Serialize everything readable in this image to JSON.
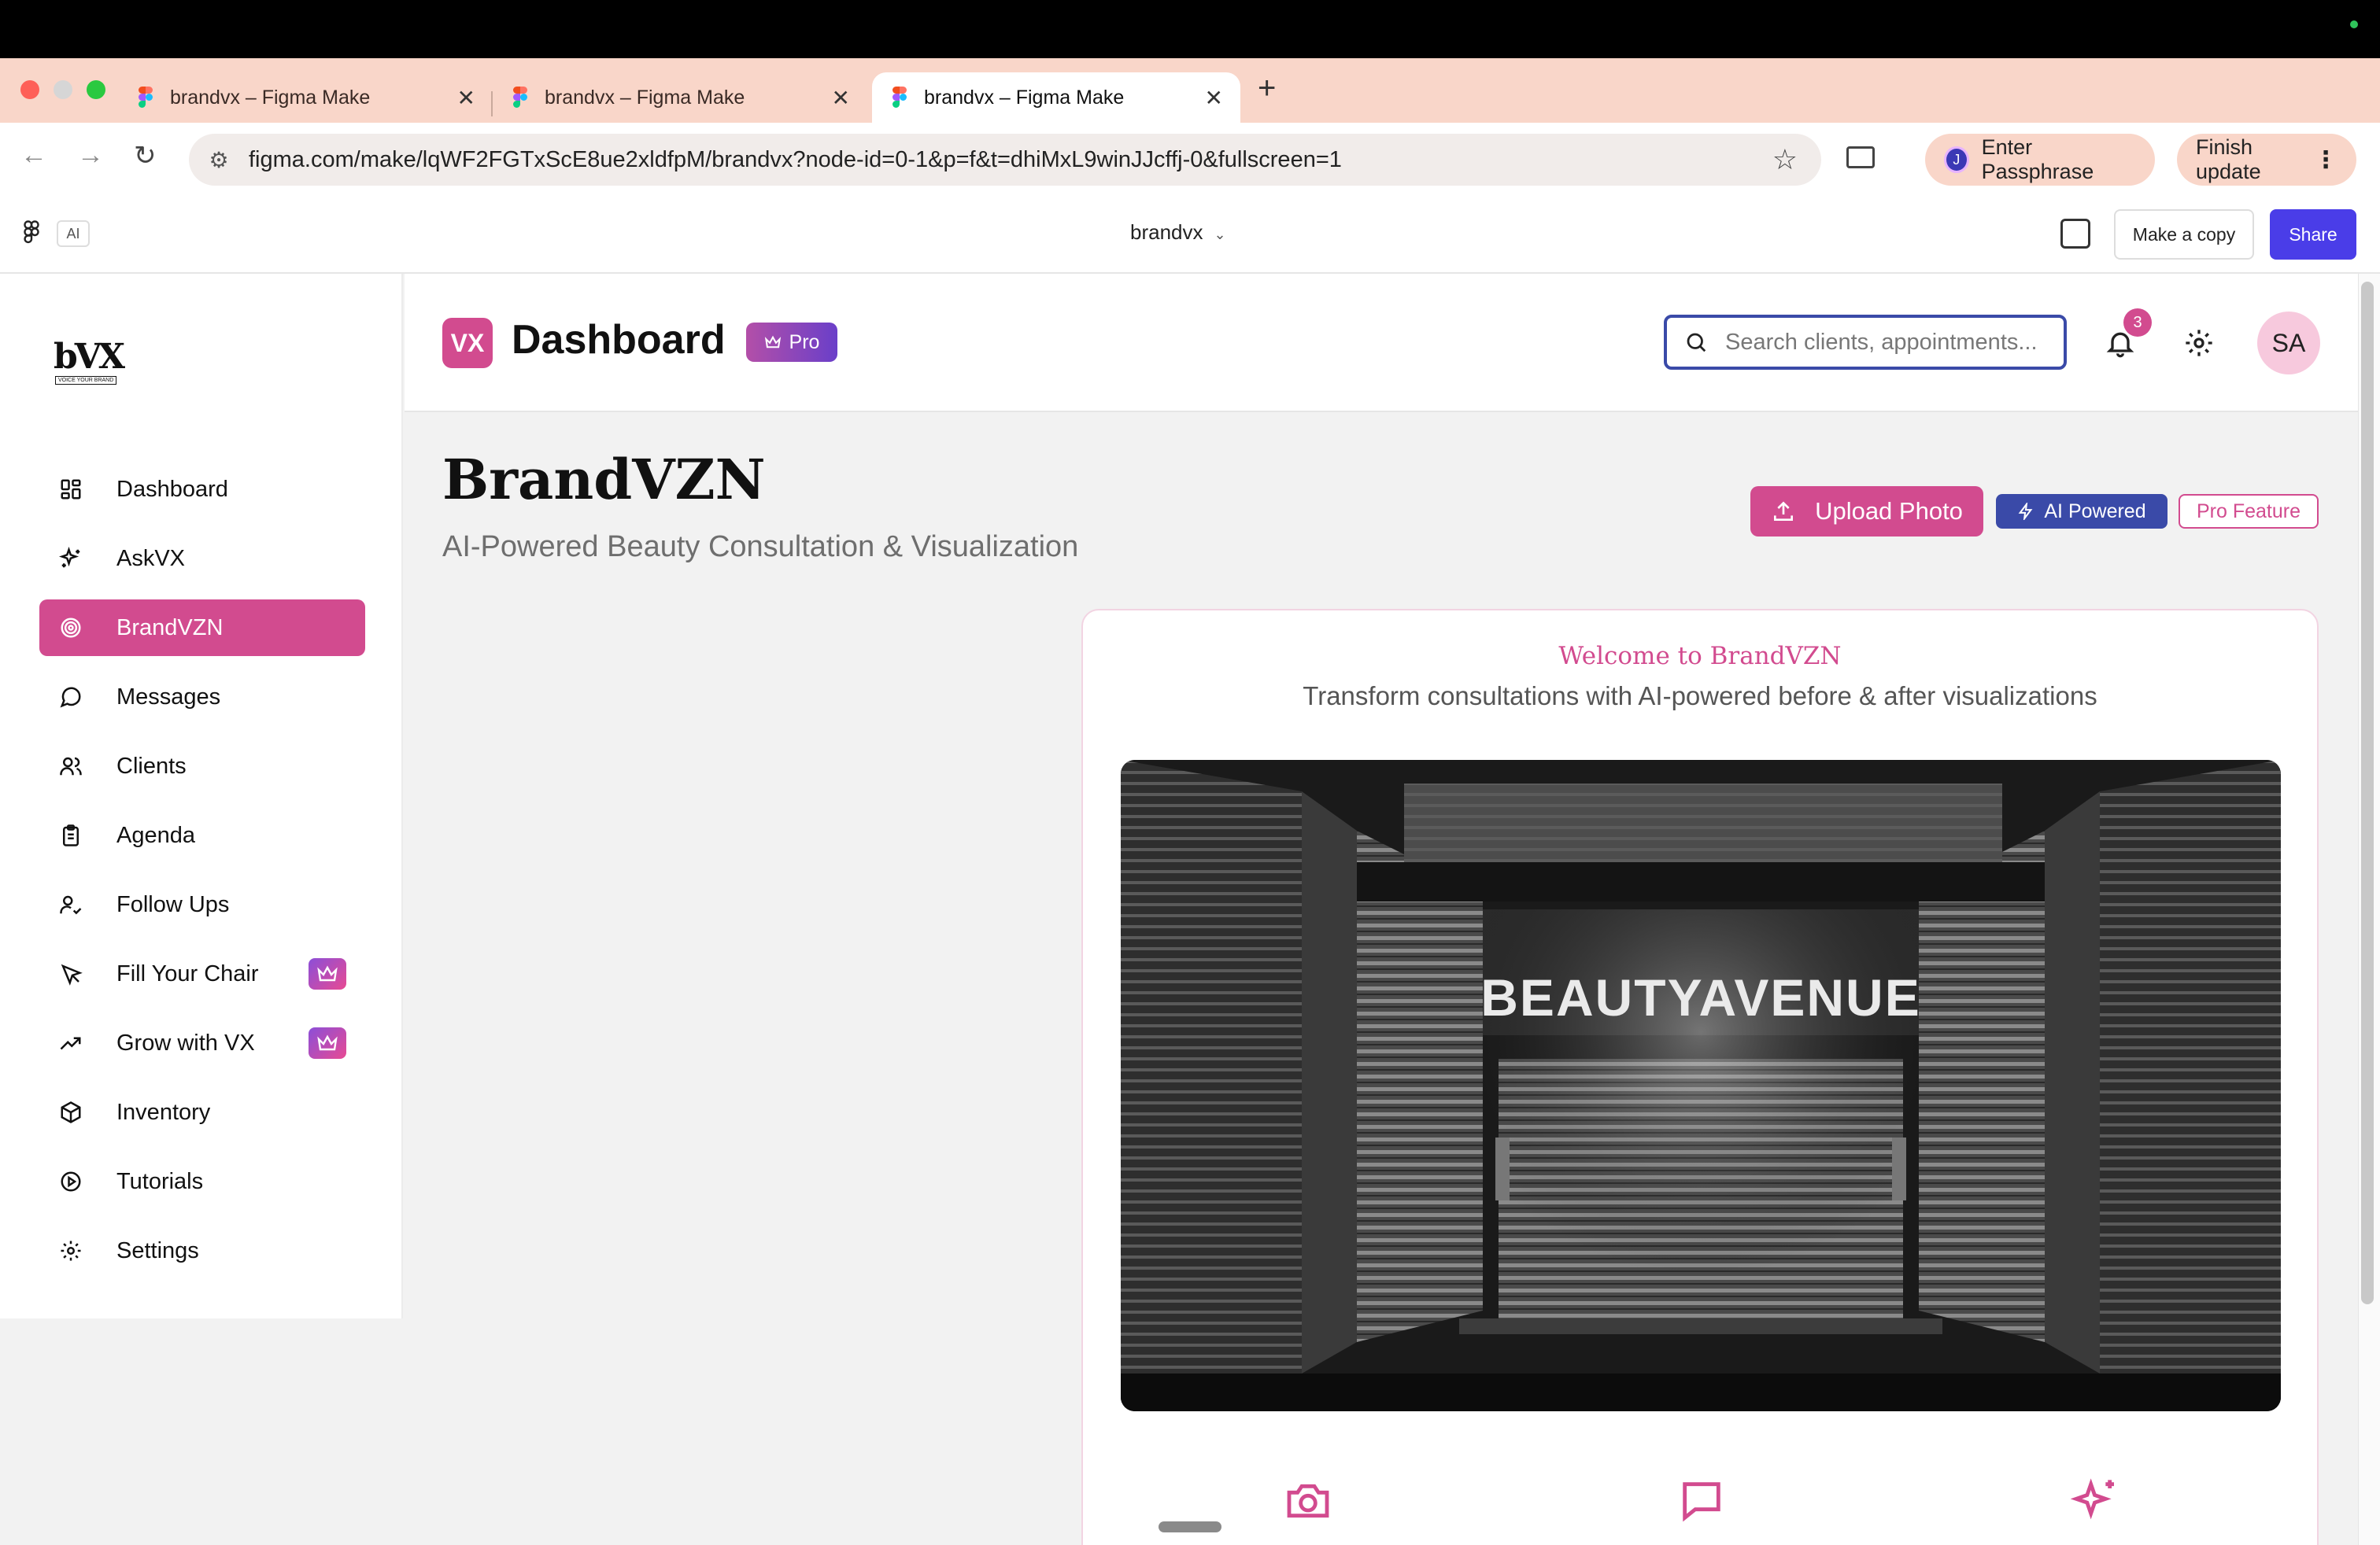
{
  "browser": {
    "tabs": [
      {
        "title": "brandvx – Figma Make",
        "close": "✕"
      },
      {
        "title": "brandvx – Figma Make",
        "close": "✕"
      },
      {
        "title": "brandvx – Figma Make",
        "close": "✕"
      }
    ],
    "new_tab": "+",
    "url": "figma.com/make/lqWF2FGTxScE8ue2xldfpM/brandvx?node-id=0-1&p=f&t=dhiMxL9winJJcffj-0&fullscreen=1",
    "profile_initial": "J",
    "passphrase_label": "Enter Passphrase",
    "update_label": "Finish update"
  },
  "figma": {
    "ai_tag": "AI",
    "file_name": "brandvx",
    "make_copy_label": "Make a copy",
    "share_label": "Share"
  },
  "sidebar": {
    "logo_text": "bVX",
    "logo_subtext": "VOICE YOUR BRAND",
    "items": [
      {
        "label": "Dashboard",
        "icon": "grid-icon",
        "active": false,
        "pro": false
      },
      {
        "label": "AskVX",
        "icon": "sparkles-icon",
        "active": false,
        "pro": false
      },
      {
        "label": "BrandVZN",
        "icon": "target-icon",
        "active": true,
        "pro": false
      },
      {
        "label": "Messages",
        "icon": "message-icon",
        "active": false,
        "pro": false
      },
      {
        "label": "Clients",
        "icon": "users-icon",
        "active": false,
        "pro": false
      },
      {
        "label": "Agenda",
        "icon": "clipboard-icon",
        "active": false,
        "pro": false
      },
      {
        "label": "Follow Ups",
        "icon": "user-check-icon",
        "active": false,
        "pro": false
      },
      {
        "label": "Fill Your Chair",
        "icon": "cursor-icon",
        "active": false,
        "pro": true
      },
      {
        "label": "Grow with VX",
        "icon": "trending-up-icon",
        "active": false,
        "pro": true
      },
      {
        "label": "Inventory",
        "icon": "box-icon",
        "active": false,
        "pro": false
      },
      {
        "label": "Tutorials",
        "icon": "play-circle-icon",
        "active": false,
        "pro": false
      },
      {
        "label": "Settings",
        "icon": "gear-icon",
        "active": false,
        "pro": false
      }
    ]
  },
  "header": {
    "logo": "VX",
    "title": "Dashboard",
    "badge": "Pro",
    "search_placeholder": "Search clients, appointments...",
    "notifications": "3",
    "avatar_initials": "SA"
  },
  "main": {
    "title": "BrandVZN",
    "subtitle": "AI-Powered Beauty Consultation & Visualization",
    "upload_label": "Upload Photo",
    "ai_tag": "AI Powered",
    "pro_tag": "Pro Feature",
    "card": {
      "welcome": "Welcome to BrandVZN",
      "welcome_sub": "Transform consultations with AI-powered before & after visualizations",
      "photo_sign": "BEAUTYAVENUE",
      "features": [
        "camera-icon",
        "message-icon",
        "sparkles-icon"
      ]
    }
  },
  "colors": {
    "accent": "#d24b8f",
    "indigo": "#3a4aa8",
    "share": "#4a3de8",
    "tabstrip": "#f9d6c9"
  }
}
